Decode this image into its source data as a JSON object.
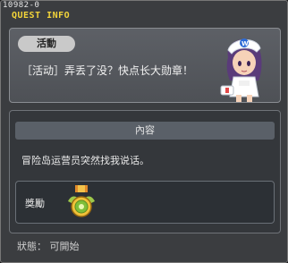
{
  "window": {
    "quest_id": "10982-0",
    "title": "QUEST INFO"
  },
  "quest": {
    "category_badge": "活動",
    "title": "［活动］弄丢了没？快点长大勋章！",
    "npc_icon": "nurse-npc-icon"
  },
  "content": {
    "header": "內容",
    "text": "冒险岛运营员突然找我说话。"
  },
  "reward": {
    "label": "獎勵",
    "item_icon": "medal-icon"
  },
  "status": {
    "text": "狀態： 可開始"
  },
  "colors": {
    "title_yellow": "#f2d43a",
    "panel_bg": "#55585d",
    "content_bg": "#34373b"
  }
}
